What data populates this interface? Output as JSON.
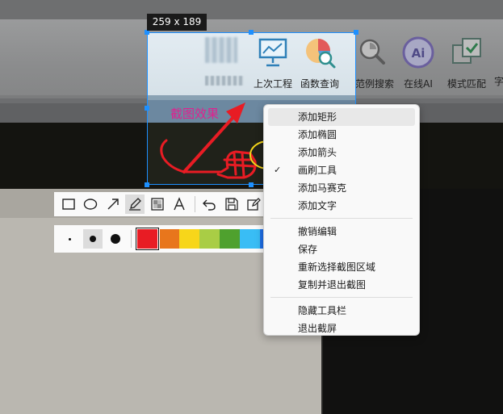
{
  "selection": {
    "size_label": "259 x 189"
  },
  "ribbon": {
    "buttons": [
      {
        "label": "上次工程",
        "icon": "presentation-board-icon"
      },
      {
        "label": "函数查询",
        "icon": "pie-chart-search-icon"
      },
      {
        "label": "范例搜索",
        "icon": "magnifier-chart-icon"
      },
      {
        "label": "在线AI",
        "icon": "ai-circle-icon"
      },
      {
        "label": "模式匹配",
        "icon": "checkbox-match-icon"
      },
      {
        "label": "字"
      }
    ]
  },
  "annotation": {
    "text": "截图效果",
    "color": "#e0208f",
    "stroke_color": "#e81c24"
  },
  "toolbar": {
    "tools": [
      "rectangle-icon",
      "ellipse-icon",
      "arrow-icon",
      "pen-icon",
      "mosaic-icon",
      "text-icon",
      "undo-icon",
      "save-icon",
      "edit-icon"
    ],
    "active_tool": "pen-icon"
  },
  "palette": {
    "sizes": [
      "small",
      "medium",
      "large"
    ],
    "active_size": "medium",
    "colors": [
      "#e81c24",
      "#e8761c",
      "#f7d61a",
      "#a9cd45",
      "#4fa12e",
      "#39bdf5",
      "#1e6fe8"
    ],
    "selected_color": "#e81c24"
  },
  "menu": {
    "group1": [
      {
        "label": "添加矩形",
        "checked": false
      },
      {
        "label": "添加椭圆",
        "checked": false
      },
      {
        "label": "添加箭头",
        "checked": false
      },
      {
        "label": "画刷工具",
        "checked": true
      },
      {
        "label": "添加马赛克",
        "checked": false
      },
      {
        "label": "添加文字",
        "checked": false
      }
    ],
    "group2": [
      {
        "label": "撤销编辑"
      },
      {
        "label": "保存"
      },
      {
        "label": "重新选择截图区域"
      },
      {
        "label": "复制并退出截图"
      }
    ],
    "group3": [
      {
        "label": "隐藏工具栏"
      },
      {
        "label": "退出截屏"
      }
    ],
    "check_glyph": "✓"
  }
}
